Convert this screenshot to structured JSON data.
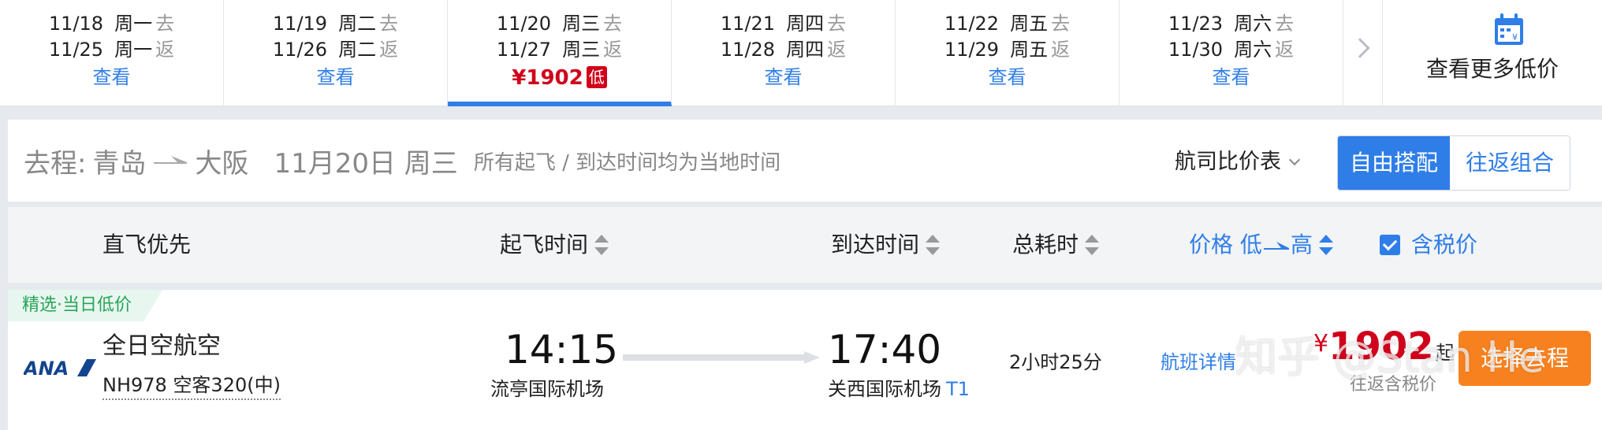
{
  "date_strip": {
    "cells": [
      {
        "out_date": "11/18",
        "out_weekday": "周一",
        "out_dir": "去",
        "ret_date": "11/25",
        "ret_weekday": "周一",
        "ret_dir": "返",
        "link": "查看"
      },
      {
        "out_date": "11/19",
        "out_weekday": "周二",
        "out_dir": "去",
        "ret_date": "11/26",
        "ret_weekday": "周二",
        "ret_dir": "返",
        "link": "查看"
      },
      {
        "out_date": "11/20",
        "out_weekday": "周三",
        "out_dir": "去",
        "ret_date": "11/27",
        "ret_weekday": "周三",
        "ret_dir": "返",
        "price": "¥1902",
        "price_tag": "低"
      },
      {
        "out_date": "11/21",
        "out_weekday": "周四",
        "out_dir": "去",
        "ret_date": "11/28",
        "ret_weekday": "周四",
        "ret_dir": "返",
        "link": "查看"
      },
      {
        "out_date": "11/22",
        "out_weekday": "周五",
        "out_dir": "去",
        "ret_date": "11/29",
        "ret_weekday": "周五",
        "ret_dir": "返",
        "link": "查看"
      },
      {
        "out_date": "11/23",
        "out_weekday": "周六",
        "out_dir": "去",
        "ret_date": "11/30",
        "ret_weekday": "周六",
        "ret_dir": "返",
        "link": "查看"
      }
    ],
    "selected_index": 2,
    "more_low_price_label": "查看更多低价"
  },
  "route": {
    "leg_label": "去程:",
    "from_city": "青岛",
    "to_city": "大阪",
    "date": "11月20日 周三",
    "note": "所有起飞 / 到达时间均为当地时间",
    "compare_label": "航司比价表",
    "toggle_active": "自由搭配",
    "toggle_inactive": "往返组合"
  },
  "columns": {
    "direct_first": "直飞优先",
    "departure": "起飞时间",
    "arrival": "到达时间",
    "duration": "总耗时",
    "price_prefix": "价格",
    "price_low": "低",
    "price_high": "高",
    "tax_included": "含税价"
  },
  "flight": {
    "feature_tag": "精选·当日低价",
    "airline_logo_text": "ANA",
    "airline_name": "全日空航空",
    "flight_info": "NH978 空客320(中)",
    "dep_time": "14:15",
    "dep_airport": "流亭国际机场",
    "arr_time": "17:40",
    "arr_airport": "关西国际机场",
    "arr_terminal": "T1",
    "total_duration": "2小时25分",
    "detail_link": "航班详情",
    "price_symbol": "¥",
    "price": "1902",
    "price_suffix": "起",
    "price_note": "往返含税价",
    "choose_button": "选择去程"
  },
  "watermark": "知乎 @Stan He",
  "colors": {
    "accent_blue": "#2f7ee8",
    "price_red": "#d0021b",
    "button_orange": "#f7811f",
    "tag_green": "#2aa35a"
  }
}
